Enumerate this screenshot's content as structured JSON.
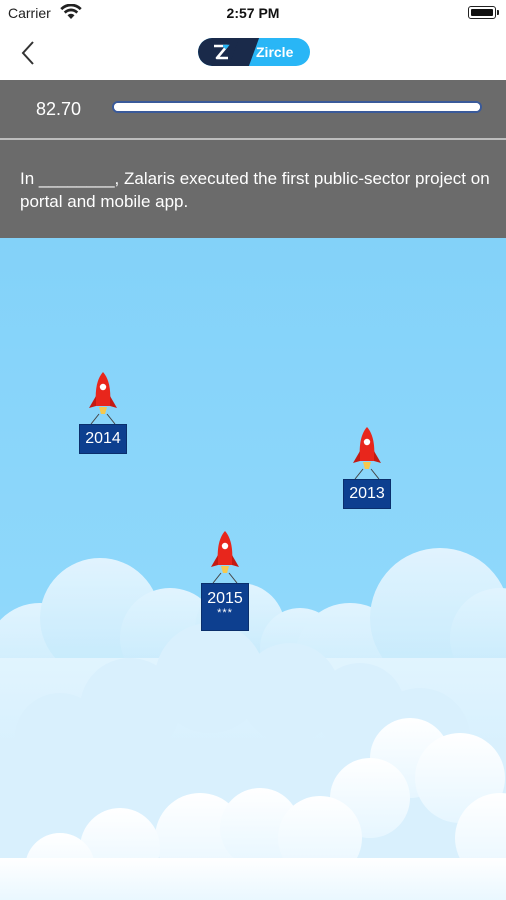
{
  "status_bar": {
    "carrier": "Carrier",
    "time": "2:57 PM"
  },
  "nav": {
    "brand_name": "Zircle"
  },
  "score": {
    "value": "82.70",
    "progress": 1.0
  },
  "question": {
    "text": "In ________, Zalaris executed the first public-sector project on portal and mobile app."
  },
  "rockets": [
    {
      "label": "2014",
      "stars": ""
    },
    {
      "label": "2013",
      "stars": ""
    },
    {
      "label": "2015",
      "stars": "***"
    }
  ],
  "colors": {
    "sky": "#83d2f9",
    "sign": "#0d3f8f",
    "rocket": "#e8261c",
    "panel": "#6b6b6b",
    "brand": "#29b6f6"
  }
}
